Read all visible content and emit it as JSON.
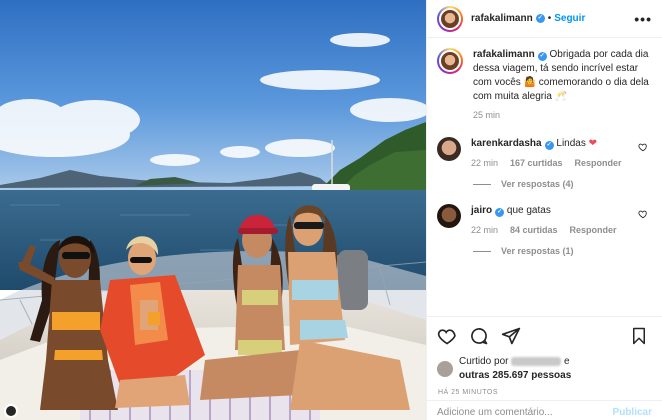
{
  "post": {
    "author": "rafakalimann",
    "follow_label": "Seguir",
    "separator": "•",
    "more_label": "•••",
    "caption": "Obrigada por cada dia dessa viagem, tá sendo incrível estar com vocês 🤷 comemorando o dia dela com muita alegria 🥂",
    "caption_time": "25 min"
  },
  "comments": [
    {
      "user": "karenkardasha",
      "verified": true,
      "text": "Lindas",
      "emoji": "❤",
      "time": "22 min",
      "likes": "167 curtidas",
      "reply_label": "Responder",
      "view_replies": "Ver respostas (4)"
    },
    {
      "user": "jairo",
      "verified": true,
      "text": "que gatas",
      "emoji": "",
      "time": "22 min",
      "likes": "84 curtidas",
      "reply_label": "Responder",
      "view_replies": "Ver respostas (1)"
    }
  ],
  "likes_summary": {
    "prefix": "Curtido por",
    "connector": "e",
    "others": "outras 285.697 pessoas"
  },
  "post_time": "HÁ 25 MINUTOS",
  "comment_box": {
    "placeholder": "Adicione um comentário...",
    "publish_label": "Publicar"
  },
  "colors": {
    "accent": "#0095f6",
    "verified": "#3897f0",
    "heart": "#ed4956",
    "muted": "#8e8e8e"
  },
  "icons": [
    "verified-badge-icon",
    "heart-icon",
    "comment-icon",
    "share-icon",
    "bookmark-icon",
    "more-options-icon"
  ]
}
